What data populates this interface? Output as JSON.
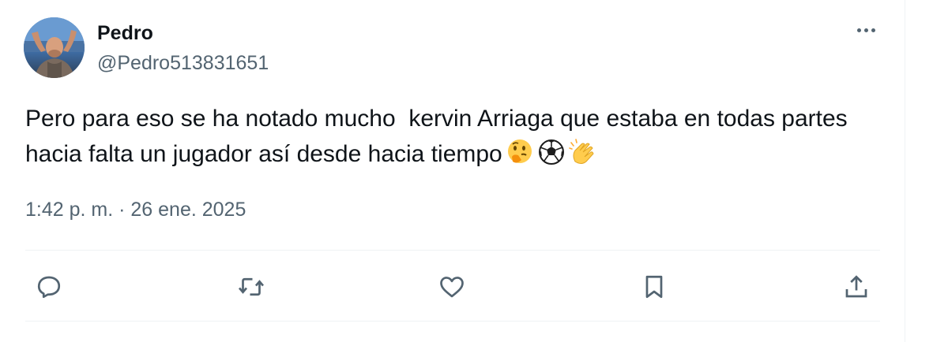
{
  "tweet": {
    "author_name": "Pedro",
    "author_handle": "@Pedro513831651",
    "text": "Pero para eso se ha notado mucho  kervin Arriaga que estaba en todas partes hacia falta un jugador así desde hacia tiempo",
    "emojis": [
      "thinking-face",
      "soccer-ball",
      "clapping-hands"
    ],
    "timestamp": "1:42 p. m. · 26 ene. 2025"
  },
  "actions": [
    "reply-icon",
    "retweet-icon",
    "like-icon",
    "bookmark-icon",
    "share-icon"
  ],
  "colors": {
    "text": "#0f1419",
    "secondary": "#536471",
    "divider": "#eff3f4"
  }
}
